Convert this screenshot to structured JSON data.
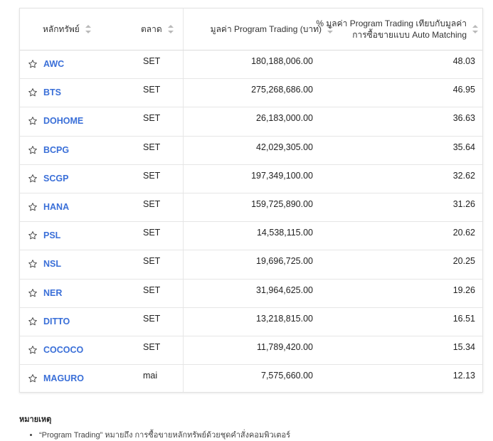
{
  "table": {
    "headers": {
      "symbol": "หลักทรัพย์",
      "market": "ตลาด",
      "value": "มูลค่า Program Trading (บาท)",
      "percent_line1": "% มูลค่า Program Trading เทียบกับมูลค่า",
      "percent_line2": "การซื้อขายแบบ Auto Matching"
    },
    "rows": [
      {
        "symbol": "AWC",
        "market": "SET",
        "value": "180,188,006.00",
        "percent": "48.03"
      },
      {
        "symbol": "BTS",
        "market": "SET",
        "value": "275,268,686.00",
        "percent": "46.95"
      },
      {
        "symbol": "DOHOME",
        "market": "SET",
        "value": "26,183,000.00",
        "percent": "36.63"
      },
      {
        "symbol": "BCPG",
        "market": "SET",
        "value": "42,029,305.00",
        "percent": "35.64"
      },
      {
        "symbol": "SCGP",
        "market": "SET",
        "value": "197,349,100.00",
        "percent": "32.62"
      },
      {
        "symbol": "HANA",
        "market": "SET",
        "value": "159,725,890.00",
        "percent": "31.26"
      },
      {
        "symbol": "PSL",
        "market": "SET",
        "value": "14,538,115.00",
        "percent": "20.62"
      },
      {
        "symbol": "NSL",
        "market": "SET",
        "value": "19,696,725.00",
        "percent": "20.25"
      },
      {
        "symbol": "NER",
        "market": "SET",
        "value": "31,964,625.00",
        "percent": "19.26"
      },
      {
        "symbol": "DITTO",
        "market": "SET",
        "value": "13,218,815.00",
        "percent": "16.51"
      },
      {
        "symbol": "COCOCO",
        "market": "SET",
        "value": "11,789,420.00",
        "percent": "15.34"
      },
      {
        "symbol": "MAGURO",
        "market": "mai",
        "value": "7,575,660.00",
        "percent": "12.13"
      }
    ]
  },
  "notes": {
    "title": "หมายเหตุ",
    "items": [
      "“Program Trading” หมายถึง การซื้อขายหลักทรัพย์ด้วยชุดคำสั่งคอมพิวเตอร์"
    ]
  },
  "colors": {
    "link": "#3a6fd8",
    "divider": "#e6e6e6",
    "sort_icon": "#b9b9b9"
  }
}
